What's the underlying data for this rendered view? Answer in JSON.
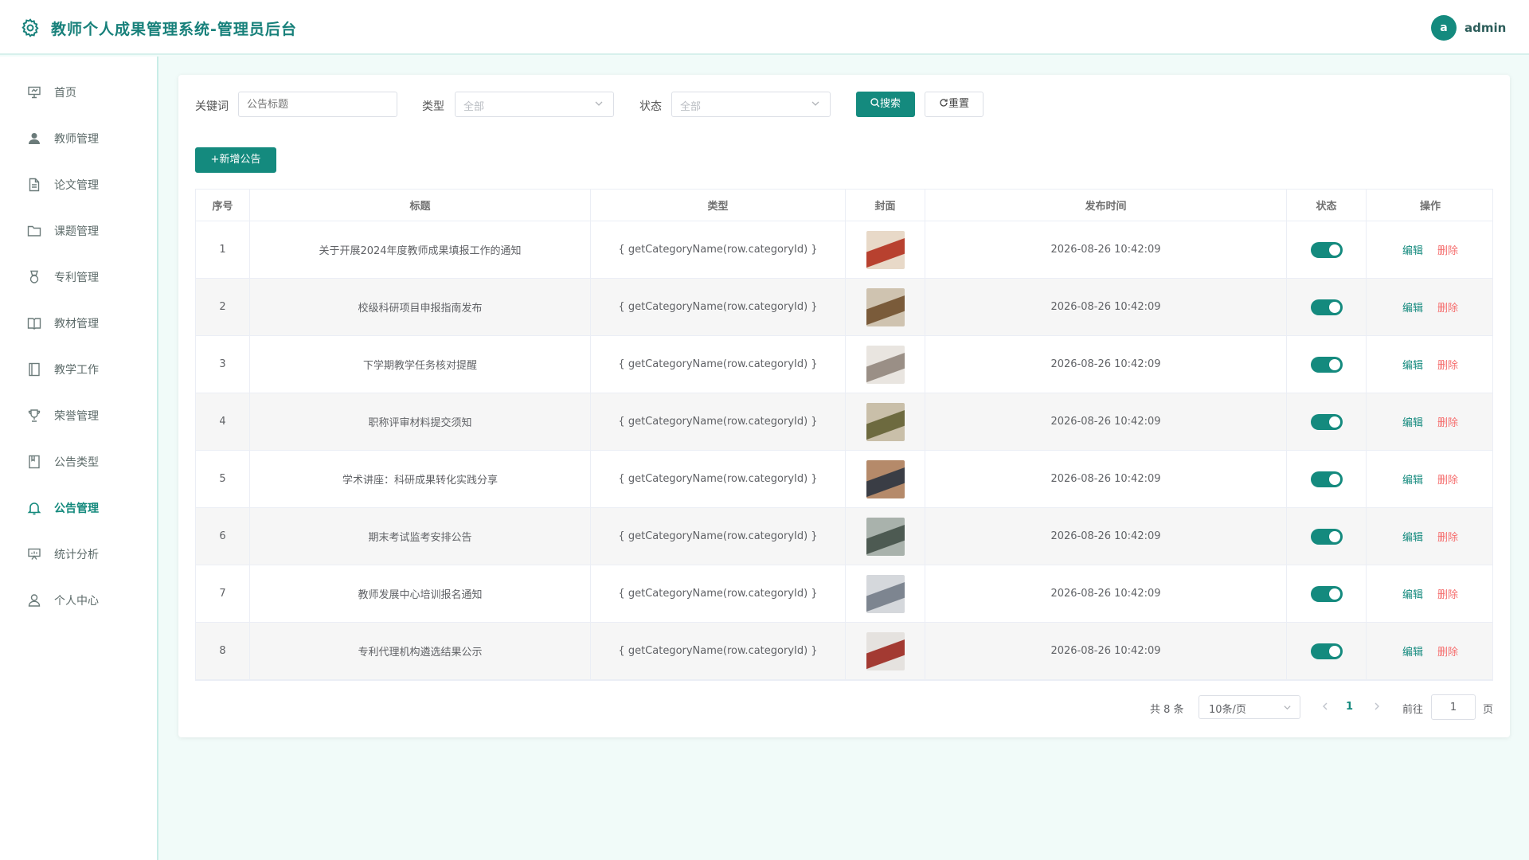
{
  "header": {
    "title": "教师个人成果管理系统-管理员后台",
    "avatar_letter": "a",
    "username": "admin"
  },
  "sidebar": {
    "items": [
      {
        "label": "首页",
        "icon": "monitor-icon"
      },
      {
        "label": "教师管理",
        "icon": "user-icon"
      },
      {
        "label": "论文管理",
        "icon": "document-icon"
      },
      {
        "label": "课题管理",
        "icon": "folder-icon"
      },
      {
        "label": "专利管理",
        "icon": "medal-icon"
      },
      {
        "label": "教材管理",
        "icon": "book-open-icon"
      },
      {
        "label": "教学工作",
        "icon": "notebook-icon"
      },
      {
        "label": "荣誉管理",
        "icon": "trophy-icon"
      },
      {
        "label": "公告类型",
        "icon": "collection-icon"
      },
      {
        "label": "公告管理",
        "icon": "bell-icon"
      },
      {
        "label": "统计分析",
        "icon": "presentation-icon"
      },
      {
        "label": "个人中心",
        "icon": "user-outline-icon"
      }
    ],
    "active": "公告管理"
  },
  "filters": {
    "keyword_label": "关键词",
    "keyword_placeholder": "公告标题",
    "type_label": "类型",
    "type_value": "全部",
    "status_label": "状态",
    "status_value": "全部",
    "search_label": "搜索",
    "reset_label": "重置"
  },
  "toolbar": {
    "add_label": "新增公告"
  },
  "table": {
    "columns": [
      "序号",
      "标题",
      "类型",
      "封面",
      "发布时间",
      "状态",
      "操作"
    ],
    "rows": [
      {
        "index": "1",
        "title": "关于开展2024年度教师成果填报工作的通知",
        "type": "{ getCategoryName(row.categoryId) }",
        "time": "2026-08-26 10:42:09",
        "enabled": true
      },
      {
        "index": "2",
        "title": "校级科研项目申报指南发布",
        "type": "{ getCategoryName(row.categoryId) }",
        "time": "2026-08-26 10:42:09",
        "enabled": true
      },
      {
        "index": "3",
        "title": "下学期教学任务核对提醒",
        "type": "{ getCategoryName(row.categoryId) }",
        "time": "2026-08-26 10:42:09",
        "enabled": true
      },
      {
        "index": "4",
        "title": "职称评审材料提交须知",
        "type": "{ getCategoryName(row.categoryId) }",
        "time": "2026-08-26 10:42:09",
        "enabled": true
      },
      {
        "index": "5",
        "title": "学术讲座：科研成果转化实践分享",
        "type": "{ getCategoryName(row.categoryId) }",
        "time": "2026-08-26 10:42:09",
        "enabled": true
      },
      {
        "index": "6",
        "title": "期末考试监考安排公告",
        "type": "{ getCategoryName(row.categoryId) }",
        "time": "2026-08-26 10:42:09",
        "enabled": true
      },
      {
        "index": "7",
        "title": "教师发展中心培训报名通知",
        "type": "{ getCategoryName(row.categoryId) }",
        "time": "2026-08-26 10:42:09",
        "enabled": true
      },
      {
        "index": "8",
        "title": "专利代理机构遴选结果公示",
        "type": "{ getCategoryName(row.categoryId) }",
        "time": "2026-08-26 10:42:09",
        "enabled": true
      }
    ],
    "edit_label": "编辑",
    "delete_label": "删除"
  },
  "pagination": {
    "total_text": "共 8 条",
    "page_size": "10条/页",
    "current_page": "1",
    "goto_label": "前往",
    "goto_value": "1",
    "page_suffix": "页"
  },
  "colors": {
    "accent": "#148a7e",
    "danger": "#f56c6c",
    "background": "#f1fbf9"
  }
}
